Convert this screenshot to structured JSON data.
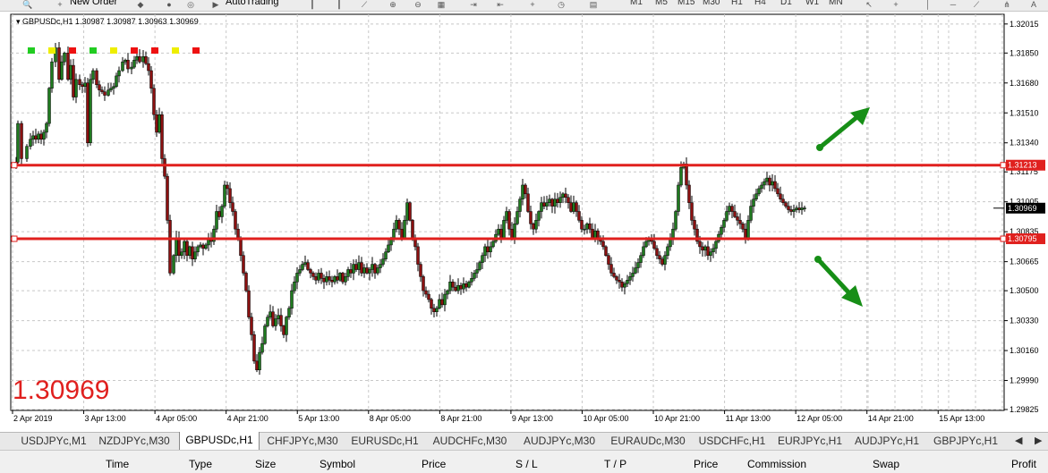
{
  "toolbar": {
    "new_order_label": "New Order",
    "autotrading_label": "AutoTrading",
    "timeframes": [
      "M1",
      "M5",
      "M15",
      "M30",
      "H1",
      "H4",
      "D1",
      "W1",
      "MN"
    ]
  },
  "chart": {
    "header": "GBPUSDc,H1  1.30987 1.30987 1.30963 1.30969",
    "big_price": "1.30969"
  },
  "chart_data": {
    "type": "candlestick",
    "symbol": "GBPUSDc",
    "timeframe": "H1",
    "ylim": [
      1.2982,
      1.3207
    ],
    "price_ticks": [
      "1.32015",
      "1.31850",
      "1.31680",
      "1.31510",
      "1.31340",
      "1.31175",
      "1.31005",
      "1.30835",
      "1.30665",
      "1.30500",
      "1.30330",
      "1.30160",
      "1.29990",
      "1.29825"
    ],
    "time_labels": [
      "2 Apr 2019",
      "3 Apr 13:00",
      "4 Apr 05:00",
      "4 Apr 21:00",
      "5 Apr 13:00",
      "8 Apr 05:00",
      "8 Apr 21:00",
      "9 Apr 13:00",
      "10 Apr 05:00",
      "10 Apr 21:00",
      "11 Apr 13:00",
      "12 Apr 05:00",
      "14 Apr 21:00",
      "15 Apr 13:00"
    ],
    "hlines": [
      {
        "price": 1.31213,
        "label": "1.31213",
        "color": "#e0201e"
      },
      {
        "price": 1.30795,
        "label": "1.30795",
        "color": "#e0201e"
      }
    ],
    "current_price": {
      "value": 1.30969,
      "label": "1.30969"
    },
    "signal_squares": [
      "#22cc22",
      "#eeee00",
      "#ee1111",
      "#22cc22",
      "#eeee00",
      "#ee1111",
      "#ee1111",
      "#eeee00",
      "#ee1111"
    ],
    "arrows": [
      {
        "direction": "up",
        "color": "#168e16"
      },
      {
        "direction": "down",
        "color": "#168e16"
      }
    ],
    "grid": true,
    "bull_color": "#1f7a1f",
    "bear_color": "#8b1010",
    "path": [
      [
        1.3123,
        6
      ],
      [
        1.3145,
        8
      ],
      [
        1.3125,
        12
      ],
      [
        1.3132,
        18
      ],
      [
        1.3136,
        22
      ],
      [
        1.3138,
        25
      ],
      [
        1.3136,
        28
      ],
      [
        1.3139,
        31
      ],
      [
        1.3136,
        34
      ],
      [
        1.314,
        37
      ],
      [
        1.3145,
        40
      ],
      [
        1.3165,
        43
      ],
      [
        1.318,
        46
      ],
      [
        1.3188,
        50
      ],
      [
        1.317,
        54
      ],
      [
        1.318,
        57
      ],
      [
        1.3185,
        60
      ],
      [
        1.317,
        64
      ],
      [
        1.3178,
        67
      ],
      [
        1.316,
        70
      ],
      [
        1.317,
        73
      ],
      [
        1.3167,
        77
      ],
      [
        1.3166,
        80
      ],
      [
        1.3168,
        83
      ],
      [
        1.3134,
        86
      ],
      [
        1.317,
        89
      ],
      [
        1.3175,
        92
      ],
      [
        1.3167,
        96
      ],
      [
        1.3164,
        99
      ],
      [
        1.3163,
        102
      ],
      [
        1.3161,
        105
      ],
      [
        1.3164,
        109
      ],
      [
        1.3165,
        112
      ],
      [
        1.3166,
        115
      ],
      [
        1.3172,
        118
      ],
      [
        1.3175,
        121
      ],
      [
        1.318,
        125
      ],
      [
        1.3181,
        128
      ],
      [
        1.3176,
        131
      ],
      [
        1.3177,
        135
      ],
      [
        1.3181,
        138
      ],
      [
        1.3183,
        141
      ],
      [
        1.318,
        144
      ],
      [
        1.3183,
        148
      ],
      [
        1.3179,
        151
      ],
      [
        1.3175,
        154
      ],
      [
        1.3165,
        157
      ],
      [
        1.315,
        160
      ],
      [
        1.314,
        163
      ],
      [
        1.315,
        166
      ],
      [
        1.3125,
        169
      ],
      [
        1.3115,
        172
      ],
      [
        1.309,
        175
      ],
      [
        1.306,
        178
      ],
      [
        1.307,
        182
      ],
      [
        1.308,
        185
      ],
      [
        1.307,
        188
      ],
      [
        1.3072,
        191
      ],
      [
        1.3078,
        194
      ],
      [
        1.307,
        197
      ],
      [
        1.3075,
        200
      ],
      [
        1.3068,
        203
      ],
      [
        1.3072,
        206
      ],
      [
        1.3075,
        209
      ],
      [
        1.3076,
        212
      ],
      [
        1.3074,
        215
      ],
      [
        1.3076,
        218
      ],
      [
        1.308,
        221
      ],
      [
        1.3078,
        224
      ],
      [
        1.3085,
        227
      ],
      [
        1.3095,
        230
      ],
      [
        1.3092,
        233
      ],
      [
        1.3098,
        236
      ],
      [
        1.311,
        239
      ],
      [
        1.3108,
        242
      ],
      [
        1.31,
        245
      ],
      [
        1.3095,
        248
      ],
      [
        1.3085,
        251
      ],
      [
        1.308,
        254
      ],
      [
        1.307,
        257
      ],
      [
        1.306,
        260
      ],
      [
        1.305,
        263
      ],
      [
        1.3035,
        266
      ],
      [
        1.3025,
        269
      ],
      [
        1.301,
        272
      ],
      [
        1.3005,
        275
      ],
      [
        1.3015,
        278
      ],
      [
        1.302,
        281
      ],
      [
        1.303,
        284
      ],
      [
        1.3035,
        287
      ],
      [
        1.3038,
        290
      ],
      [
        1.303,
        293
      ],
      [
        1.3034,
        296
      ],
      [
        1.3036,
        299
      ],
      [
        1.303,
        302
      ],
      [
        1.3025,
        305
      ],
      [
        1.3035,
        308
      ],
      [
        1.304,
        311
      ],
      [
        1.305,
        314
      ],
      [
        1.3055,
        317
      ],
      [
        1.306,
        320
      ],
      [
        1.3062,
        323
      ],
      [
        1.3065,
        326
      ],
      [
        1.3066,
        329
      ],
      [
        1.3062,
        332
      ],
      [
        1.306,
        335
      ],
      [
        1.3058,
        338
      ],
      [
        1.3056,
        341
      ],
      [
        1.306,
        344
      ],
      [
        1.3057,
        347
      ],
      [
        1.3055,
        350
      ],
      [
        1.3058,
        353
      ],
      [
        1.3056,
        356
      ],
      [
        1.3055,
        359
      ],
      [
        1.3058,
        362
      ],
      [
        1.3056,
        365
      ],
      [
        1.306,
        368
      ],
      [
        1.3055,
        371
      ],
      [
        1.3058,
        374
      ],
      [
        1.3062,
        377
      ],
      [
        1.306,
        380
      ],
      [
        1.3065,
        383
      ],
      [
        1.3062,
        386
      ],
      [
        1.3066,
        389
      ],
      [
        1.306,
        392
      ],
      [
        1.3063,
        395
      ],
      [
        1.306,
        398
      ],
      [
        1.3062,
        401
      ],
      [
        1.3065,
        404
      ],
      [
        1.306,
        407
      ],
      [
        1.3063,
        410
      ],
      [
        1.3065,
        413
      ],
      [
        1.3068,
        416
      ],
      [
        1.3072,
        419
      ],
      [
        1.3076,
        422
      ],
      [
        1.308,
        425
      ],
      [
        1.3085,
        428
      ],
      [
        1.309,
        431
      ],
      [
        1.3085,
        434
      ],
      [
        1.308,
        437
      ],
      [
        1.309,
        440
      ],
      [
        1.31,
        443
      ],
      [
        1.309,
        446
      ],
      [
        1.308,
        449
      ],
      [
        1.3075,
        452
      ],
      [
        1.3065,
        455
      ],
      [
        1.3058,
        458
      ],
      [
        1.305,
        461
      ],
      [
        1.3048,
        464
      ],
      [
        1.3045,
        467
      ],
      [
        1.304,
        470
      ],
      [
        1.3038,
        473
      ],
      [
        1.304,
        476
      ],
      [
        1.3045,
        479
      ],
      [
        1.3042,
        482
      ],
      [
        1.3048,
        485
      ],
      [
        1.305,
        488
      ],
      [
        1.3055,
        491
      ],
      [
        1.3052,
        494
      ],
      [
        1.305,
        497
      ],
      [
        1.3053,
        500
      ],
      [
        1.3051,
        503
      ],
      [
        1.3054,
        506
      ],
      [
        1.3052,
        509
      ],
      [
        1.3055,
        512
      ],
      [
        1.3057,
        515
      ],
      [
        1.306,
        518
      ],
      [
        1.3062,
        521
      ],
      [
        1.3066,
        524
      ],
      [
        1.307,
        527
      ],
      [
        1.3075,
        530
      ],
      [
        1.3072,
        533
      ],
      [
        1.3075,
        536
      ],
      [
        1.3078,
        539
      ],
      [
        1.3082,
        542
      ],
      [
        1.3085,
        545
      ],
      [
        1.308,
        548
      ],
      [
        1.309,
        551
      ],
      [
        1.3095,
        554
      ],
      [
        1.3085,
        557
      ],
      [
        1.308,
        560
      ],
      [
        1.3088,
        563
      ],
      [
        1.3095,
        566
      ],
      [
        1.3102,
        569
      ],
      [
        1.311,
        572
      ],
      [
        1.3105,
        575
      ],
      [
        1.3095,
        578
      ],
      [
        1.3088,
        581
      ],
      [
        1.3085,
        584
      ],
      [
        1.309,
        587
      ],
      [
        1.3095,
        590
      ],
      [
        1.31,
        593
      ],
      [
        1.3098,
        596
      ],
      [
        1.31,
        599
      ],
      [
        1.3102,
        602
      ],
      [
        1.3098,
        605
      ],
      [
        1.3102,
        608
      ],
      [
        1.31,
        611
      ],
      [
        1.3103,
        614
      ],
      [
        1.3105,
        617
      ],
      [
        1.3103,
        620
      ],
      [
        1.31,
        623
      ],
      [
        1.3095,
        626
      ],
      [
        1.31,
        629
      ],
      [
        1.3095,
        632
      ],
      [
        1.309,
        635
      ],
      [
        1.3085,
        638
      ],
      [
        1.3085,
        641
      ],
      [
        1.3088,
        644
      ],
      [
        1.3085,
        647
      ],
      [
        1.308,
        650
      ],
      [
        1.3084,
        653
      ],
      [
        1.308,
        656
      ],
      [
        1.3078,
        659
      ],
      [
        1.3075,
        662
      ],
      [
        1.307,
        665
      ],
      [
        1.3065,
        668
      ],
      [
        1.306,
        671
      ],
      [
        1.3058,
        674
      ],
      [
        1.3056,
        677
      ],
      [
        1.3055,
        680
      ],
      [
        1.3052,
        683
      ],
      [
        1.3054,
        686
      ],
      [
        1.3056,
        689
      ],
      [
        1.3058,
        692
      ],
      [
        1.306,
        695
      ],
      [
        1.3063,
        698
      ],
      [
        1.3066,
        701
      ],
      [
        1.307,
        704
      ],
      [
        1.3075,
        707
      ],
      [
        1.3078,
        710
      ],
      [
        1.308,
        713
      ],
      [
        1.3078,
        716
      ],
      [
        1.3074,
        719
      ],
      [
        1.307,
        722
      ],
      [
        1.3068,
        725
      ],
      [
        1.3065,
        728
      ],
      [
        1.307,
        731
      ],
      [
        1.3075,
        734
      ],
      [
        1.308,
        737
      ],
      [
        1.3085,
        740
      ],
      [
        1.3095,
        743
      ],
      [
        1.311,
        746
      ],
      [
        1.312,
        749
      ],
      [
        1.3122,
        752
      ],
      [
        1.311,
        755
      ],
      [
        1.31,
        758
      ],
      [
        1.309,
        761
      ],
      [
        1.3085,
        764
      ],
      [
        1.3078,
        767
      ],
      [
        1.3075,
        770
      ],
      [
        1.3073,
        773
      ],
      [
        1.3075,
        776
      ],
      [
        1.307,
        779
      ],
      [
        1.3072,
        782
      ],
      [
        1.3074,
        785
      ],
      [
        1.3078,
        788
      ],
      [
        1.3082,
        791
      ],
      [
        1.3086,
        794
      ],
      [
        1.309,
        797
      ],
      [
        1.3095,
        800
      ],
      [
        1.3098,
        803
      ],
      [
        1.3095,
        806
      ],
      [
        1.3092,
        809
      ],
      [
        1.309,
        812
      ],
      [
        1.3088,
        815
      ],
      [
        1.3085,
        818
      ],
      [
        1.308,
        821
      ],
      [
        1.309,
        824
      ],
      [
        1.3098,
        827
      ],
      [
        1.3102,
        830
      ],
      [
        1.3105,
        833
      ],
      [
        1.3108,
        836
      ],
      [
        1.311,
        839
      ],
      [
        1.3112,
        842
      ],
      [
        1.3114,
        845
      ],
      [
        1.311,
        848
      ],
      [
        1.3112,
        851
      ],
      [
        1.3108,
        854
      ],
      [
        1.3105,
        857
      ],
      [
        1.3102,
        860
      ],
      [
        1.31,
        863
      ],
      [
        1.3098,
        866
      ],
      [
        1.3096,
        869
      ],
      [
        1.3095,
        872
      ],
      [
        1.3096,
        875
      ],
      [
        1.3097,
        878
      ],
      [
        1.3096,
        881
      ],
      [
        1.3097,
        884
      ],
      [
        1.3097,
        887
      ]
    ]
  },
  "tabs": [
    "USDJPYc,M1",
    "NZDJPYc,M30",
    "GBPUSDc,H1",
    "CHFJPYc,M30",
    "EURUSDc,H1",
    "AUDCHFc,M30",
    "AUDJPYc,M30",
    "EURAUDc,M30",
    "USDCHFc,H1",
    "EURJPYc,H1",
    "AUDJPYc,H1",
    "GBPJPYc,H1"
  ],
  "active_tab_index": 2,
  "tab_nav": {
    "prev": "◀",
    "next": "▶"
  },
  "terminal_columns": [
    "Time",
    "Type",
    "Size",
    "Symbol",
    "Price",
    "S / L",
    "T / P",
    "Price",
    "Commission",
    "Swap",
    "Profit"
  ]
}
